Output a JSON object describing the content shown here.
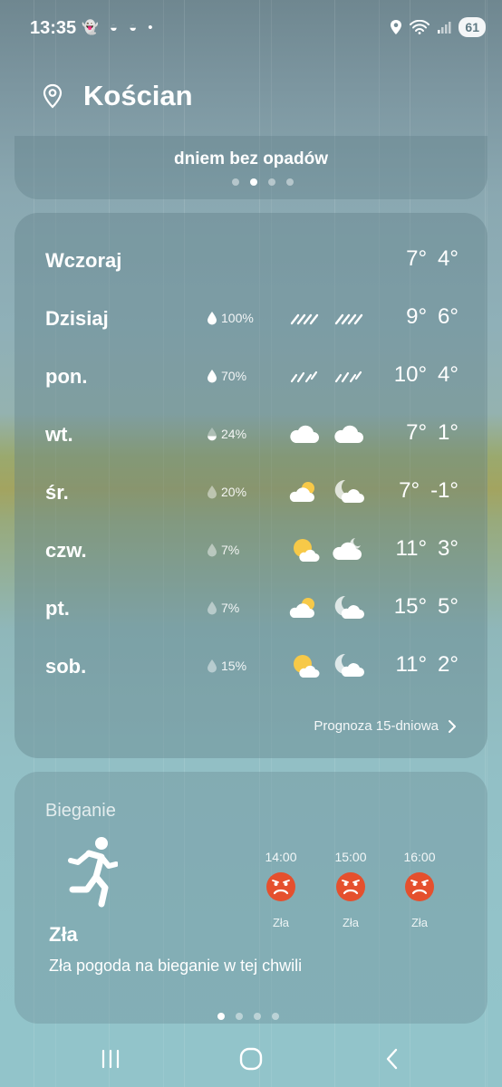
{
  "status_bar": {
    "time": "13:35",
    "notifications": "👻 ◒ ◒ •",
    "battery": "61"
  },
  "header": {
    "city": "Kościan"
  },
  "top_card": {
    "message": "dniem bez opadów"
  },
  "forecast": {
    "rows": [
      {
        "day": "Wczoraj",
        "precip": "",
        "icon_day": "",
        "icon_night": "",
        "high": "7°",
        "low": "4°"
      },
      {
        "day": "Dzisiaj",
        "precip": "100%",
        "icon_day": "rain-icon",
        "icon_night": "rain-icon",
        "high": "9°",
        "low": "6°"
      },
      {
        "day": "pon.",
        "precip": "70%",
        "icon_day": "rain-icon",
        "icon_night": "rain-icon",
        "high": "10°",
        "low": "4°"
      },
      {
        "day": "wt.",
        "precip": "24%",
        "icon_day": "cloud-icon",
        "icon_night": "cloud-icon",
        "high": "7°",
        "low": "1°"
      },
      {
        "day": "śr.",
        "precip": "20%",
        "icon_day": "partly-sunny-icon",
        "icon_night": "moon-cloud-icon",
        "high": "7°",
        "low": "-1°"
      },
      {
        "day": "czw.",
        "precip": "7%",
        "icon_day": "sun-cloud-icon",
        "icon_night": "cloud-moon-icon",
        "high": "11°",
        "low": "3°"
      },
      {
        "day": "pt.",
        "precip": "7%",
        "icon_day": "partly-sunny-icon",
        "icon_night": "moon-cloud-icon",
        "high": "15°",
        "low": "5°"
      },
      {
        "day": "sob.",
        "precip": "15%",
        "icon_day": "sun-cloud-icon",
        "icon_night": "moon-cloud-icon",
        "high": "11°",
        "low": "2°"
      }
    ],
    "more_label": "Prognoza 15-dniowa"
  },
  "running": {
    "title": "Bieganie",
    "status": "Zła",
    "description": "Zła pogoda na bieganie w tej chwili",
    "slots": [
      {
        "time": "14:00",
        "label": "Zła"
      },
      {
        "time": "15:00",
        "label": "Zła"
      },
      {
        "time": "16:00",
        "label": "Zła"
      }
    ]
  },
  "colors": {
    "bad_face": "#e5502e",
    "sun": "#f7c948"
  }
}
